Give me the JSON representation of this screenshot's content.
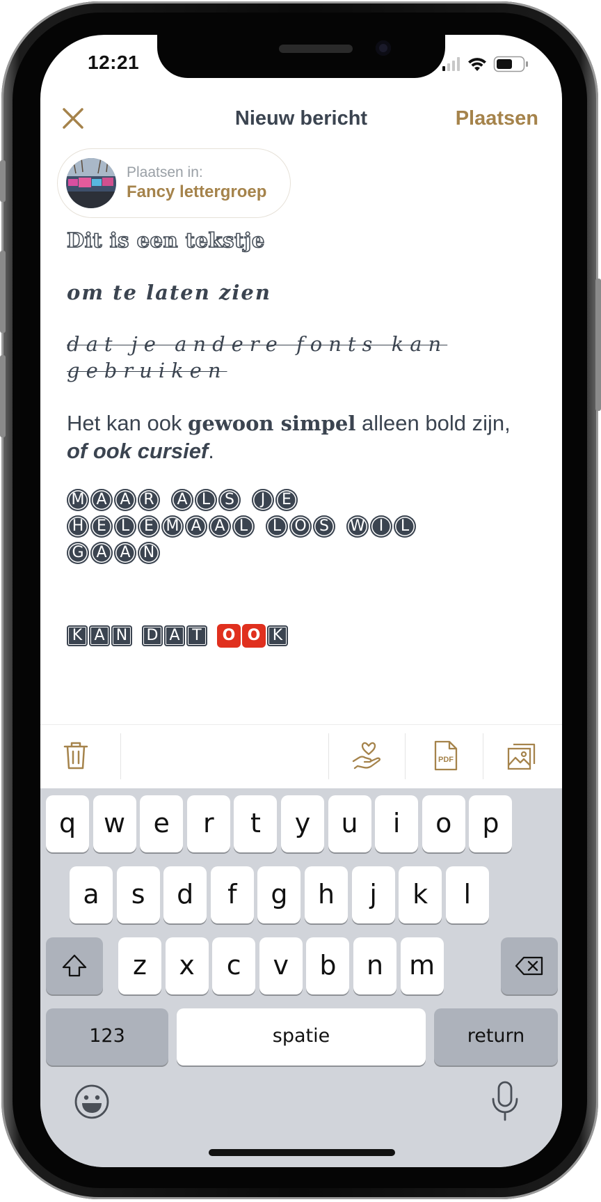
{
  "status_bar": {
    "time": "12:21"
  },
  "header": {
    "title": "Nieuw bericht",
    "post_label": "Plaatsen"
  },
  "group": {
    "post_in_label": "Plaatsen in:",
    "name": "Fancy lettergroep"
  },
  "content": {
    "line1": "Dit is een tekstje",
    "line2": "om te laten zien",
    "line3": "dat je andere fonts kan gebruiken",
    "line4_before": "Het kan ook ",
    "line4_bold": "gewoon simpel",
    "line4_after": " alleen bold zijn,",
    "line4_italic": "of ook cursief",
    "line4_end": ".",
    "circled_words": [
      "MAAR",
      "ALS",
      "JE",
      "HELEMAAL",
      "LOS",
      "WIL",
      "GAAN"
    ],
    "squared_words": [
      "KAN",
      "DAT",
      "OOK"
    ]
  },
  "toolbar": {
    "icons": [
      "trash-icon",
      "donate-hand-icon",
      "pdf-icon",
      "images-icon"
    ]
  },
  "keyboard": {
    "row1": [
      "q",
      "w",
      "e",
      "r",
      "t",
      "y",
      "u",
      "i",
      "o",
      "p"
    ],
    "row2": [
      "a",
      "s",
      "d",
      "f",
      "g",
      "h",
      "j",
      "k",
      "l"
    ],
    "row3": [
      "z",
      "x",
      "c",
      "v",
      "b",
      "n",
      "m"
    ],
    "numbers_label": "123",
    "space_label": "spatie",
    "return_label": "return"
  },
  "colors": {
    "accent": "#a5834b",
    "text": "#3b4450",
    "red": "#e0301e"
  }
}
